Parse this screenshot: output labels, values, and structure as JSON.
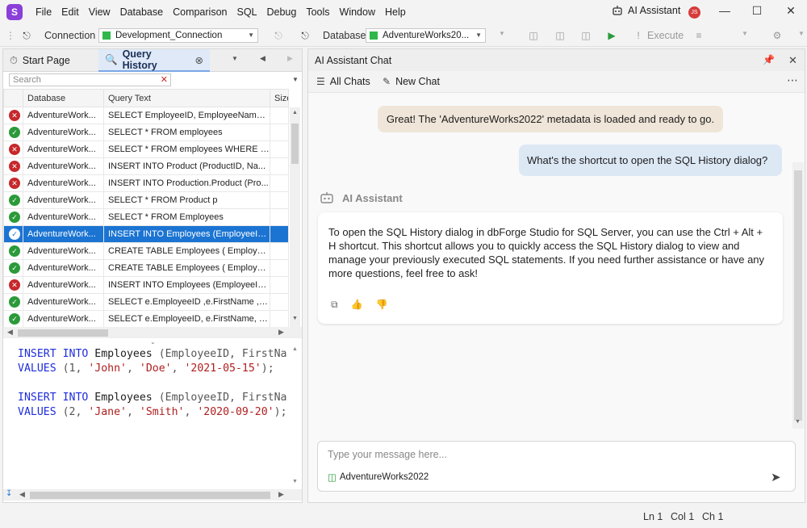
{
  "menu": {
    "items": [
      "File",
      "Edit",
      "View",
      "Database",
      "Comparison",
      "SQL",
      "Debug",
      "Tools",
      "Window",
      "Help"
    ],
    "ai_assistant_label": "AI Assistant",
    "avatar_initials": "JS"
  },
  "toolbar": {
    "connection_label": "Connection",
    "connection_value": "Development_Connection",
    "database_label": "Database",
    "database_value": "AdventureWorks20...",
    "execute_label": "Execute",
    "status_color": "#2fb84a"
  },
  "left_tabs": {
    "start_page": "Start Page",
    "query_history": "Query History"
  },
  "history": {
    "search_placeholder": "Search",
    "columns": [
      "Database",
      "Query Text",
      "Size (B"
    ],
    "rows": [
      {
        "status": "err",
        "db": "AdventureWork...",
        "query": "SELECT EmployeeID, EmployeeName, ..."
      },
      {
        "status": "ok",
        "db": "AdventureWork...",
        "query": "SELECT * FROM employees"
      },
      {
        "status": "err",
        "db": "AdventureWork...",
        "query": "SELECT * FROM employees WHERE fir..."
      },
      {
        "status": "err",
        "db": "AdventureWork...",
        "query": "INSERT INTO Product (ProductID, Na..."
      },
      {
        "status": "err",
        "db": "AdventureWork...",
        "query": "INSERT INTO Production.Product (Pro..."
      },
      {
        "status": "ok",
        "db": "AdventureWork...",
        "query": "SELECT * FROM Product p"
      },
      {
        "status": "ok",
        "db": "AdventureWork...",
        "query": "SELECT * FROM Employees"
      },
      {
        "status": "sel",
        "db": "AdventureWork...",
        "query": "INSERT INTO Employees (EmployeeID, ..."
      },
      {
        "status": "ok",
        "db": "AdventureWork...",
        "query": " CREATE TABLE Employees ( Employee..."
      },
      {
        "status": "ok",
        "db": "AdventureWork...",
        "query": " CREATE TABLE Employees ( Employee..."
      },
      {
        "status": "err",
        "db": "AdventureWork...",
        "query": "INSERT INTO Employees (EmployeeID,..."
      },
      {
        "status": "ok",
        "db": "AdventureWork...",
        "query": "SELECT e.EmployeeID ,e.FirstName ,e..."
      },
      {
        "status": "ok",
        "db": "AdventureWork...",
        "query": "SELECT e.EmployeeID, e.FirstName, e..."
      }
    ]
  },
  "code": {
    "kw_insert": "INSERT INTO",
    "table1": " Employees ",
    "cols": "(EmployeeID, FirstNa",
    "kw_values": "VALUES",
    "row1_open": " (1, ",
    "row1_s1": "'John'",
    "row1_s2": "'Doe'",
    "row1_s3": "'2021-05-15'",
    "row1_close": ");",
    "row2_open": " (2, ",
    "row2_s1": "'Jane'",
    "row2_s2": "'Smith'",
    "row2_s3": "'2020-09-20'",
    "row2_close": ");",
    "sep": ", "
  },
  "chat": {
    "panel_title": "AI Assistant Chat",
    "all_chats": "All Chats",
    "new_chat": "New Chat",
    "system_message": "Great! The 'AdventureWorks2022' metadata is loaded and ready to go.",
    "user_message": "What's the shortcut to open the SQL History dialog?",
    "assistant_name": "AI Assistant",
    "assistant_reply": "To open the SQL History dialog in dbForge Studio for SQL Server, you can use the Ctrl + Alt + H shortcut. This shortcut allows you to quickly access the SQL History dialog to view and manage your previously executed SQL statements. If you need further assistance or have any more questions, feel free to ask!",
    "input_placeholder": "Type your message here...",
    "context_db": "AdventureWorks2022"
  },
  "status": {
    "ln": "Ln 1",
    "col": "Col 1",
    "ch": "Ch 1"
  }
}
